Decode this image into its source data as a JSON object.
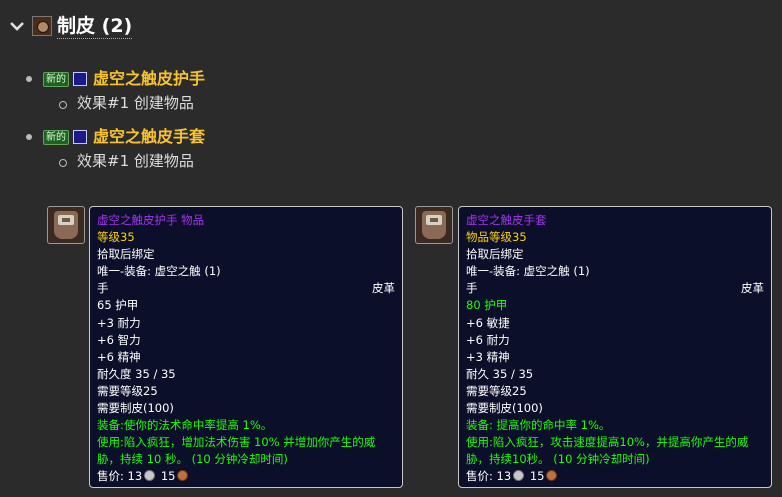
{
  "category": {
    "name": "制皮",
    "count": "(2)",
    "icon": "leatherworking-icon"
  },
  "recipes": [
    {
      "badge": "新的",
      "name": "虚空之触皮护手",
      "effect": "效果#1 创建物品"
    },
    {
      "badge": "新的",
      "name": "虚空之触皮手套",
      "effect": "效果#1 创建物品"
    }
  ],
  "tooltips": [
    {
      "icon": "glove-icon",
      "name_line": "虚空之触皮护手 物品",
      "level": "等级35",
      "bind": "拾取后绑定",
      "unique": "唯一-装备: 虚空之触 (1)",
      "slot": "手",
      "type": "皮革",
      "armor": "65 护甲",
      "stats": [
        "+3 耐力",
        "+6 智力",
        "+6 精神"
      ],
      "durability": "耐久度 35 / 35",
      "req_level": "需要等级25",
      "req_skill": "需要制皮(100)",
      "equip": "装备:使你的法术命中率提高 1%。",
      "use": "使用:陷入疯狂，增加法术伤害 10% 并增加你产生的威胁，持续 10 秒。 (10 分钟冷却时间)",
      "sell_label": "售价: ",
      "silver": "13",
      "copper": "15"
    },
    {
      "icon": "glove-icon",
      "name_line": "虚空之触皮手套",
      "level": "物品等级35",
      "bind": "拾取后绑定",
      "unique": "唯一-装备: 虚空之触 (1)",
      "slot": "手",
      "type": "皮革",
      "armor": "80 护甲",
      "stats": [
        "+6 敏捷",
        "+6 耐力",
        "+3 精神"
      ],
      "durability": "耐久 35 / 35",
      "req_level": "需要等级25",
      "req_skill": "需要制皮(100)",
      "equip": "装备: 提高你的命中率 1%。",
      "use": "使用:陷入疯狂，攻击速度提高10%，并提高你产生的威胁，持续10秒。 (10 分钟冷却时间)",
      "sell_label": "售价: ",
      "silver": "13",
      "copper": "15"
    }
  ],
  "colors": {
    "epic": "#a335ee",
    "yellow": "#ffd100",
    "green": "#1eff00",
    "recipe_name": "#f7c22b"
  }
}
